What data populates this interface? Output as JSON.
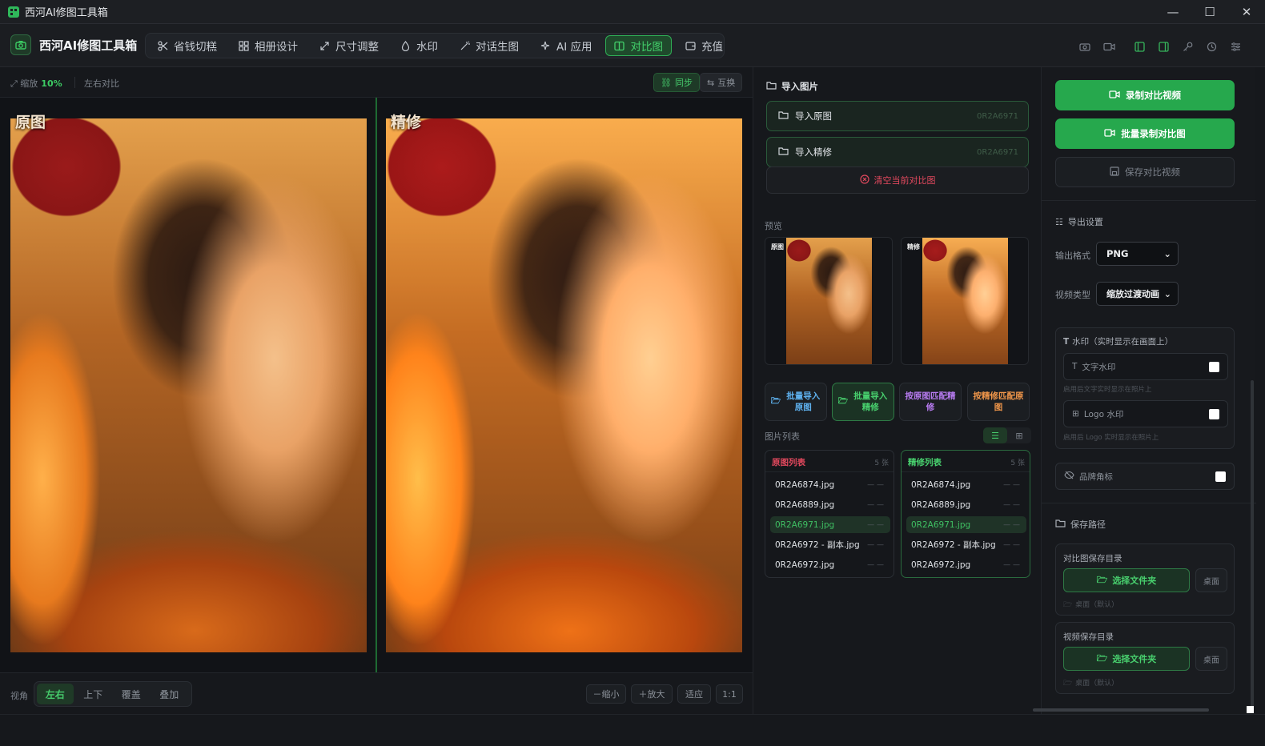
{
  "window": {
    "title": "西河AI修图工具箱",
    "minimize": "—",
    "maximize": "☐",
    "close": "✕"
  },
  "brand": {
    "name": "西河AI修图工具箱"
  },
  "nav": [
    {
      "label": "省钱切糕",
      "icon": "scissors-icon"
    },
    {
      "label": "相册设计",
      "icon": "grid-icon"
    },
    {
      "label": "尺寸调整",
      "icon": "resize-icon"
    },
    {
      "label": "水印",
      "icon": "drop-icon"
    },
    {
      "label": "对话生图",
      "icon": "magic-wand-icon"
    },
    {
      "label": "AI 应用",
      "icon": "sparkle-icon"
    },
    {
      "label": "对比图",
      "icon": "compare-icon",
      "active": true
    },
    {
      "label": "充值",
      "icon": "wallet-icon"
    }
  ],
  "viewer": {
    "zoom_label": "缩放",
    "zoom_value": "10%",
    "mode": "左右对比",
    "sync": "同步",
    "swap": "互换",
    "left_label": "原图",
    "right_label": "精修",
    "view_label": "视角",
    "views": [
      "左右",
      "上下",
      "覆盖",
      "叠加"
    ],
    "zoom_out": "－缩小",
    "zoom_in": "＋放大",
    "fit": "适应",
    "one_to_one": "1:1"
  },
  "import": {
    "title": "导入图片",
    "original": {
      "label": "导入原图",
      "value": "0R2A6971"
    },
    "retouched": {
      "label": "导入精修",
      "value": "0R2A6971"
    },
    "clear": "清空当前对比图"
  },
  "preview": {
    "title": "预览",
    "left_tag": "原图",
    "right_tag": "精修"
  },
  "batch": {
    "import_original": "批量导入原图",
    "import_retouched": "批量导入精修",
    "match_by_original": "按原图匹配精修",
    "match_by_retouched": "按精修匹配原图"
  },
  "lists": {
    "title": "图片列表",
    "original": {
      "title": "原图列表",
      "count": "5 张",
      "items": [
        "0R2A6874.jpg",
        "0R2A6889.jpg",
        "0R2A6971.jpg",
        "0R2A6972 - 副本.jpg",
        "0R2A6972.jpg"
      ]
    },
    "retouched": {
      "title": "精修列表",
      "count": "5 张",
      "items": [
        "0R2A6874.jpg",
        "0R2A6889.jpg",
        "0R2A6971.jpg",
        "0R2A6972 - 副本.jpg",
        "0R2A6972.jpg"
      ]
    },
    "dash": "— —",
    "selected_index": 2
  },
  "right": {
    "record_video": "录制对比视频",
    "batch_record": "批量录制对比图",
    "save_video": "保存对比视频",
    "export_title": "导出设置",
    "format_label": "输出格式",
    "format_value": "PNG",
    "video_type_label": "视频类型",
    "video_type_value": "缩放过渡动画",
    "watermark_title": "水印（实时显示在画面上）",
    "text_watermark": "文字水印",
    "text_hint": "启用后文字实时显示在照片上",
    "logo_watermark": "Logo 水印",
    "logo_hint": "启用后 Logo 实时显示在照片上",
    "brand_corner": "品牌角标",
    "save_path_title": "保存路径",
    "compare_dir": "对比图保存目录",
    "video_dir": "视频保存目录",
    "choose_folder": "选择文件夹",
    "desktop": "桌面",
    "default_desktop": "桌面（默认）"
  },
  "colors": {
    "accent": "#2fae55",
    "danger": "#e0485d"
  }
}
